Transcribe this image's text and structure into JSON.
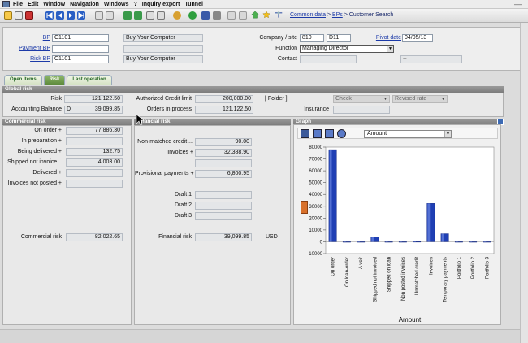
{
  "menu": [
    "File",
    "Edit",
    "Window",
    "Navigation",
    "Windows",
    "?",
    "Inquiry export",
    "Tunnel"
  ],
  "breadcrumb": {
    "part1": "Common data",
    "sep1": " > ",
    "part2": "BPs",
    "sep2": " > ",
    "part3": "Customer Search"
  },
  "header": {
    "bp_label": "BP",
    "bp_value": "C1101",
    "bp_name": "Buy Your Computer",
    "payment_bp_label": "Payment BP",
    "payment_bp_value": "",
    "risk_bp_label": "Risk BP",
    "risk_bp_value": "C1101",
    "risk_bp_name": "Buy Your Computer",
    "company_label": "Company / site",
    "company_value": "810",
    "site_value": "D11",
    "pivot_label": "Pivot date",
    "pivot_value": "04/05/13",
    "function_label": "Function",
    "function_value": "Managing Director",
    "contact_label": "Contact",
    "contact_value": "",
    "contact_extra": "--"
  },
  "tabs": [
    "Open items",
    "Risk",
    "Last operation"
  ],
  "global_risk": {
    "title": "Global risk",
    "risk_label": "Risk",
    "risk_value": "121,122.50",
    "acct_label": "Accounting Balance",
    "acct_code": "D",
    "acct_value": "39,099.85",
    "acl_label": "Authorized Credit limit",
    "acl_value": "200,000.00",
    "orders_label": "Orders in process",
    "orders_value": "121,122.50",
    "folder_label": "[ Folder ]",
    "check_value": "Check",
    "revised_value": "Revised rate",
    "insurance_label": "Insurance",
    "insurance_value": ""
  },
  "commercial": {
    "title": "Commercial risk",
    "rows": [
      {
        "label": "On order +",
        "value": "77,886.30"
      },
      {
        "label": "In preparation +",
        "value": ""
      },
      {
        "label": "Being delivered +",
        "value": "132.75"
      },
      {
        "label": "Shipped not invoice...",
        "value": "4,003.00"
      },
      {
        "label": "Delivered +",
        "value": ""
      },
      {
        "label": "Invoices not posted +",
        "value": ""
      }
    ],
    "total_label": "Commercial risk",
    "total_value": "82,022.65"
  },
  "financial": {
    "title": "Financial risk",
    "nonmatched_label": "Non-matched credit ...",
    "nonmatched_value": "90.00",
    "invoices_label": "Invoices +",
    "invoices_value": "32,388.90",
    "blank_value": "",
    "prov_label": "Provisional payments +",
    "prov_value": "6,800.95",
    "draft1_label": "Draft 1",
    "draft2_label": "Draft 2",
    "draft3_label": "Draft 3",
    "total_label": "Financial risk",
    "total_value": "39,099.85",
    "currency": "USD"
  },
  "graph": {
    "title": "Graph",
    "select_value": "Amount"
  },
  "chart_data": {
    "type": "bar",
    "categories": [
      "On order",
      "On loan-order",
      "A voir",
      "Shipped not invoiced",
      "Shipped on loan",
      "Non posted invoices",
      "Unmatched credit",
      "Invoices",
      "Temporary payments",
      "Portfolio 1",
      "Portfolio 2",
      "Portfolio 3"
    ],
    "values": [
      77886.3,
      0,
      0,
      4003.0,
      0,
      0,
      90.0,
      32388.9,
      6800.95,
      0,
      0,
      0
    ],
    "xlabel": "Amount",
    "ylim": [
      -10000,
      80000
    ],
    "yticks": [
      "80000",
      "70000",
      "60000",
      "50000",
      "40000",
      "30000",
      "20000",
      "10000",
      "0",
      "-10000"
    ],
    "bar_color": "#1f3fb4",
    "grid": false
  }
}
